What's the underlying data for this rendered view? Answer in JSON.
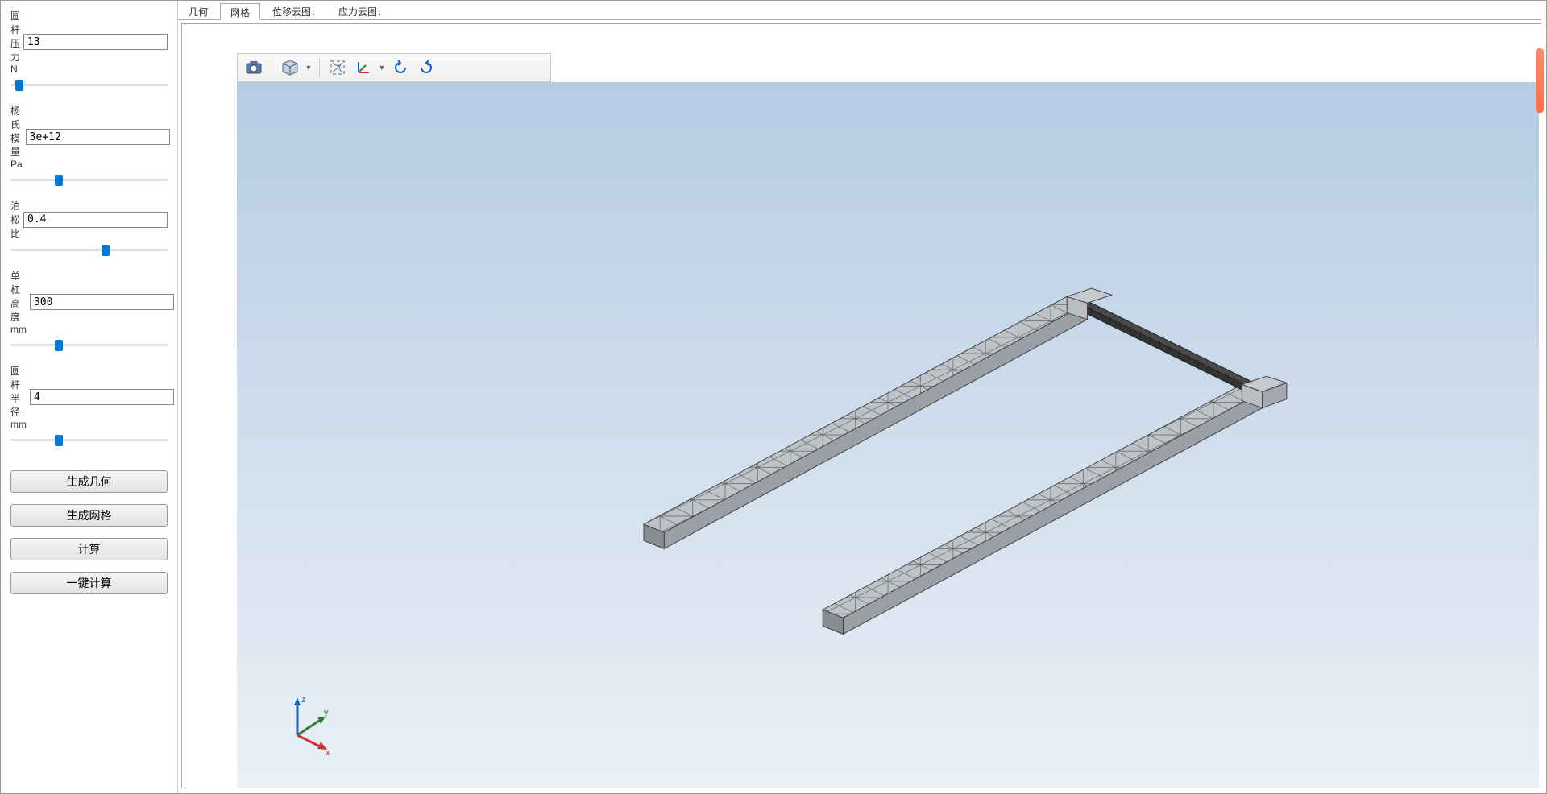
{
  "sidebar": {
    "params": [
      {
        "label": "圆杆压力N",
        "value": "13",
        "thumb": 3
      },
      {
        "label": "杨氏模量Pa",
        "value": "3e+12",
        "thumb": 28
      },
      {
        "label": "泊松比",
        "value": "0.4",
        "thumb": 58
      },
      {
        "label": "单杠高度mm",
        "value": "300",
        "thumb": 28
      },
      {
        "label": "圆杆半径mm",
        "value": "4",
        "thumb": 28
      }
    ],
    "buttons": {
      "gen_geom": "生成几何",
      "gen_mesh": "生成网格",
      "compute": "计算",
      "one_click": "一键计算"
    }
  },
  "tabs": {
    "items": [
      "几何",
      "网格",
      "位移云图↓",
      "应力云图↓"
    ],
    "active_index": 1
  },
  "toolbar": {
    "icons": [
      "camera-icon",
      "cube-icon",
      "fit-icon",
      "axes-icon",
      "rotate-cw-icon",
      "rotate-ccw-icon"
    ]
  },
  "viewport": {
    "axis_labels": {
      "x": "x",
      "y": "y",
      "z": "z"
    }
  }
}
